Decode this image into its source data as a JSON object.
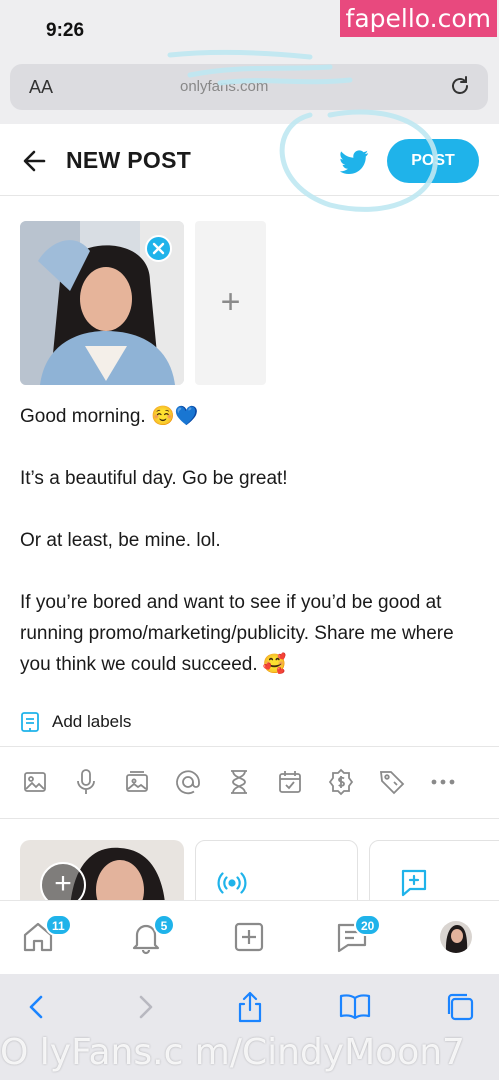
{
  "status_bar": {
    "time": "9:26"
  },
  "watermark_top": "fapello.com",
  "safari": {
    "aa_label": "AA",
    "url_text": "onlyfans.com"
  },
  "header": {
    "title": "NEW POST",
    "post_label": "POST"
  },
  "post": {
    "paragraphs": [
      "Good morning. ☺️💙",
      "It’s a beautiful day. Go be great!",
      "Or at least, be mine. lol.",
      "If you’re bored and want to see if you’d be good at running promo/marketing/publicity. Share me where you think we could succeed. 🥰"
    ]
  },
  "labels": {
    "add_labels": "Add labels"
  },
  "toolbar_icons": [
    "image-icon",
    "microphone-icon",
    "media-vault-icon",
    "mention-icon",
    "hourglass-icon",
    "calendar-icon",
    "price-icon",
    "tag-icon",
    "more-icon"
  ],
  "bottom_nav": {
    "home_badge": "11",
    "notifications_badge": "5",
    "messages_badge": "20"
  },
  "watermark_bottom": "O lyFans.c m/CindyMoon7",
  "colors": {
    "accent": "#1fb3ea",
    "brand_watermark": "#e8497e"
  }
}
